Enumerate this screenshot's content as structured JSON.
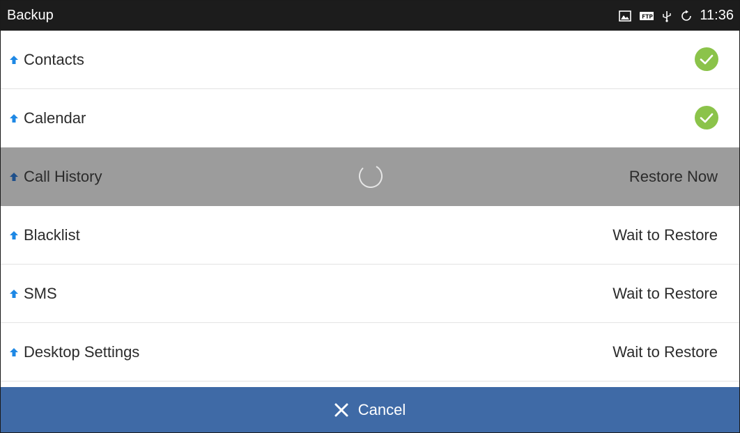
{
  "statusbar": {
    "title": "Backup",
    "icons": [
      "image-icon",
      "ftp-icon",
      "usb-icon",
      "sync-icon"
    ],
    "time": "11:36"
  },
  "items": [
    {
      "label": "Contacts",
      "status": "",
      "state": "done"
    },
    {
      "label": "Calendar",
      "status": "",
      "state": "done"
    },
    {
      "label": "Call History",
      "status": "Restore Now",
      "state": "in-progress"
    },
    {
      "label": "Blacklist",
      "status": "Wait to Restore",
      "state": "waiting"
    },
    {
      "label": "SMS",
      "status": "Wait to Restore",
      "state": "waiting"
    },
    {
      "label": "Desktop Settings",
      "status": "Wait to Restore",
      "state": "waiting"
    }
  ],
  "footer": {
    "cancel_label": "Cancel"
  },
  "colors": {
    "accent_blue": "#3f6aa6",
    "arrow_blue": "#1e88e5",
    "check_green": "#8bc34a",
    "active_row": "#9c9c9c",
    "statusbar": "#1c1c1c"
  }
}
